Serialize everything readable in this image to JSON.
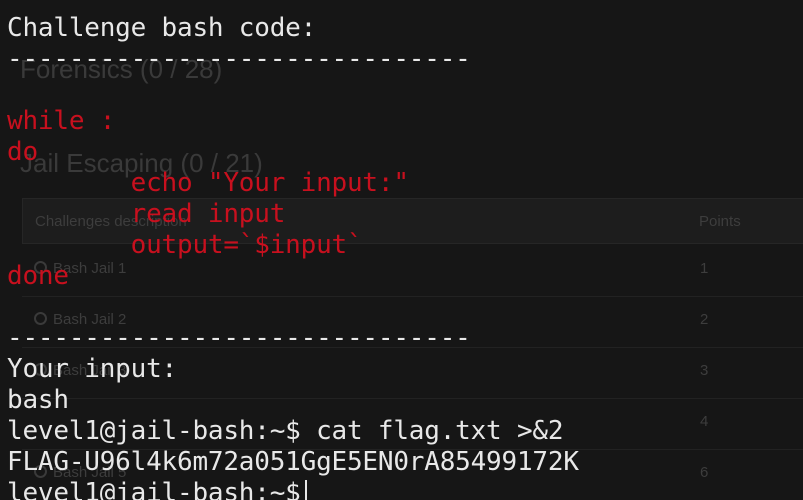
{
  "background_page": {
    "sections": [
      {
        "title": "Forensics (0 / 28)"
      },
      {
        "title": "Jail Escaping (0 / 21)"
      }
    ],
    "table": {
      "columns": [
        "Challenges description",
        "Points"
      ],
      "rows": [
        {
          "name": "Bash Jail 1",
          "points": "1"
        },
        {
          "name": "Bash Jail 2",
          "points": "2"
        },
        {
          "name": "Bash Jail 3",
          "points": "3"
        },
        {
          "name": "",
          "points": "4"
        },
        {
          "name": "Bash Jail 5",
          "points": "6"
        }
      ]
    }
  },
  "terminal": {
    "header": "Challenge bash code:",
    "separator": "------------------------------",
    "code": {
      "line1": "while :",
      "line2": "do",
      "line3": "        echo \"Your input:\"",
      "line4": "        read input",
      "line5": "        output=`$input`",
      "line6": "done"
    },
    "session": {
      "prompt_label": "Your input:",
      "user_input": "bash",
      "command_line": "level1@jail-bash:~$ cat flag.txt >&2",
      "flag_output": "FLAG-U96l4k6m72a051GgE5EN0rA85499172K",
      "current_prompt": "level1@jail-bash:~$"
    },
    "colors": {
      "foreground": "#e8e8e8",
      "code": "#c8101e",
      "background": "#161616"
    }
  }
}
